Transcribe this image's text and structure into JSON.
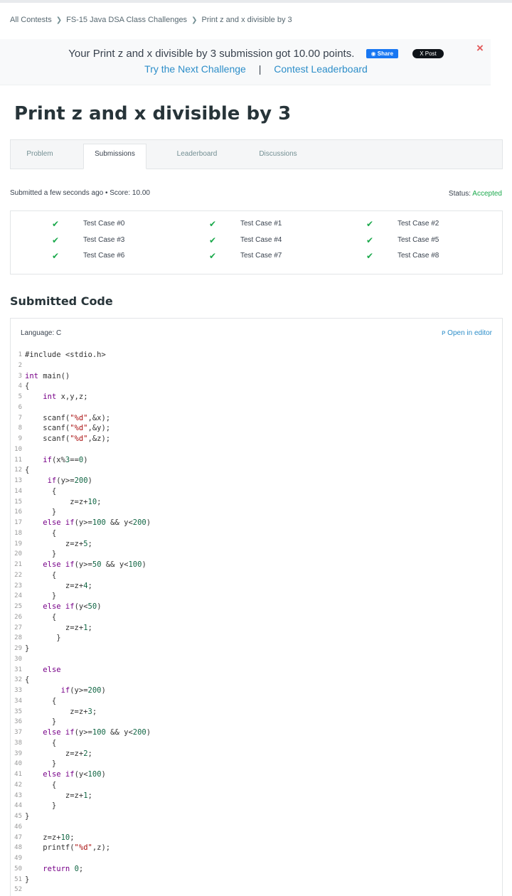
{
  "breadcrumb": [
    "All Contests",
    "FS-15 Java DSA Class Challenges",
    "Print z and x divisible by 3"
  ],
  "banner": {
    "message": "Your Print z and x divisible by 3 submission got 10.00 points.",
    "share_label": "Share",
    "post_label": "Post",
    "next_challenge": "Try the Next Challenge",
    "separator": "|",
    "leaderboard": "Contest Leaderboard",
    "close": "×"
  },
  "title": "Print z and x divisible by 3",
  "tabs": [
    {
      "label": "Problem",
      "active": false
    },
    {
      "label": "Submissions",
      "active": true
    },
    {
      "label": "Leaderboard",
      "active": false
    },
    {
      "label": "Discussions",
      "active": false
    }
  ],
  "submission": {
    "info": "Submitted a few seconds ago • Score: 10.00",
    "status_label": "Status:",
    "status_value": "Accepted"
  },
  "test_cases": [
    "Test Case #0",
    "Test Case #1",
    "Test Case #2",
    "Test Case #3",
    "Test Case #4",
    "Test Case #5",
    "Test Case #6",
    "Test Case #7",
    "Test Case #8"
  ],
  "code_section": {
    "title": "Submitted Code",
    "language": "Language: C",
    "open_editor": "Open in editor"
  },
  "code_lines": [
    "#include <stdio.h>",
    "",
    "int main()",
    "{",
    "    int x,y,z;",
    "",
    "    scanf(\"%d\",&x);",
    "    scanf(\"%d\",&y);",
    "    scanf(\"%d\",&z);",
    "",
    "    if(x%3==0)",
    "{",
    "     if(y>=200)",
    "      {",
    "          z=z+10;",
    "      }",
    "    else if(y>=100 && y<200)",
    "      {",
    "         z=z+5;",
    "      }",
    "    else if(y>=50 && y<100)",
    "      {",
    "         z=z+4;",
    "      }",
    "    else if(y<50)",
    "      {",
    "         z=z+1;",
    "       }",
    "}",
    "",
    "    else",
    "{",
    "        if(y>=200)",
    "      {",
    "          z=z+3;",
    "      }",
    "    else if(y>=100 && y<200)",
    "      {",
    "         z=z+2;",
    "      }",
    "    else if(y<100)",
    "      {",
    "         z=z+1;",
    "      }",
    "}",
    "",
    "    z=z+10;",
    "    printf(\"%d\",z);",
    "",
    "    return 0;",
    "}",
    ""
  ],
  "colors": {
    "accent": "#1ba94c",
    "link": "#2d8ec9",
    "close": "#e25c5c"
  }
}
